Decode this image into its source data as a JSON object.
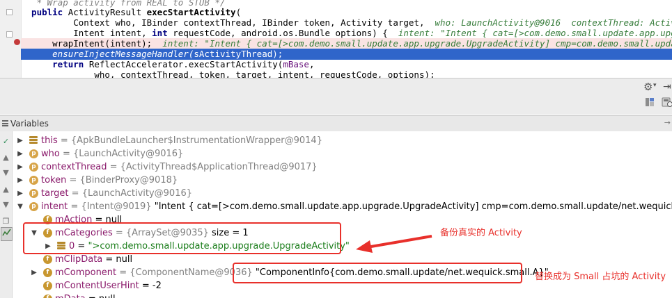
{
  "editor": {
    "lines": [
      {
        "parts": [
          {
            "t": "   * ",
            "c": "cmt"
          },
          {
            "t": "Wrap activity from REAL to STUB */",
            "c": "cmt"
          }
        ]
      },
      {
        "parts": [
          {
            "t": "  public ",
            "c": "kw"
          },
          {
            "t": "ActivityResult ",
            "c": ""
          },
          {
            "t": "execStartActivity",
            "c": "method"
          },
          {
            "t": "(",
            "c": ""
          }
        ]
      },
      {
        "parts": [
          {
            "t": "          Context who, IBinder contextThread, IBinder token, Activity target,  ",
            "c": ""
          },
          {
            "t": "who: LaunchActivity@9016  contextThread: ActivityThread$ApplicationThread@9017",
            "c": "hint"
          }
        ]
      },
      {
        "parts": [
          {
            "t": "          Intent intent, ",
            "c": ""
          },
          {
            "t": "int ",
            "c": "kw"
          },
          {
            "t": "requestCode, android.os.Bundle options) {  ",
            "c": ""
          },
          {
            "t": "intent: \"Intent { cat=[>com.demo.small.update.app.upgrade.UpgradeActivity]",
            "c": "hint"
          }
        ]
      },
      {
        "parts": [
          {
            "t": "      wrapIntent(intent);  ",
            "c": ""
          },
          {
            "t": "intent: \"Intent { cat=[>com.demo.small.update.app.upgrade.UpgradeActivity] cmp=com.demo.small.update/net.wequick.small.A }",
            "c": "hint"
          }
        ]
      },
      {
        "parts": [
          {
            "t": "      ensureInjectMessageHandler(",
            "c": "itl"
          },
          {
            "t": "sActivityThread",
            "c": "field"
          },
          {
            "t": ");",
            "c": ""
          }
        ]
      },
      {
        "parts": [
          {
            "t": "      return ",
            "c": "kw"
          },
          {
            "t": "ReflectAccelerator.",
            "c": ""
          },
          {
            "t": "execStartActivity",
            "c": "itl"
          },
          {
            "t": "(",
            "c": ""
          },
          {
            "t": "mBase",
            "c": "field"
          },
          {
            "t": ",",
            "c": ""
          }
        ]
      },
      {
        "parts": [
          {
            "t": "              who, contextThread, token, target, intent, requestCode, options);",
            "c": ""
          }
        ]
      }
    ]
  },
  "toolbar": {
    "gear_icon": "gear-icon",
    "hide_icon": "hide-icon",
    "restore_icon": "restore-layout-icon",
    "calc_icon": "evaluate-expression-icon"
  },
  "variables_panel": {
    "title": "Variables",
    "rows": [
      {
        "indent": 0,
        "arrow": "▶",
        "icon": "list",
        "name": "this",
        "value": "= {ApkBundleLauncher$InstrumentationWrapper@9014}",
        "extra": ""
      },
      {
        "indent": 0,
        "arrow": "▶",
        "icon": "p",
        "name": "who",
        "value": "= {LaunchActivity@9016}",
        "extra": ""
      },
      {
        "indent": 0,
        "arrow": "▶",
        "icon": "p",
        "name": "contextThread",
        "value": "= {ActivityThread$ApplicationThread@9017}",
        "extra": ""
      },
      {
        "indent": 0,
        "arrow": "▶",
        "icon": "p",
        "name": "token",
        "value": "= {BinderProxy@9018}",
        "extra": ""
      },
      {
        "indent": 0,
        "arrow": "▶",
        "icon": "p",
        "name": "target",
        "value": "= {LaunchActivity@9016}",
        "extra": ""
      },
      {
        "indent": 0,
        "arrow": "▼",
        "icon": "p",
        "name": "intent",
        "value": "= {Intent@9019}",
        "extra": " \"Intent { cat=[>com.demo.small.update.app.upgrade.UpgradeActivity] cmp=com.demo.small.update/net.wequick.small.A }\""
      },
      {
        "indent": 1,
        "arrow": "",
        "icon": "f",
        "name": "mAction",
        "value": "= null",
        "extra": ""
      },
      {
        "indent": 1,
        "arrow": "▼",
        "icon": "f",
        "name": "mCategories",
        "value": "= {ArraySet@9035}",
        "extra": "  size = 1"
      },
      {
        "indent": 2,
        "arrow": "▶",
        "icon": "list",
        "name": "0",
        "value": "=",
        "extra": " \">com.demo.small.update.app.upgrade.UpgradeActivity\""
      },
      {
        "indent": 1,
        "arrow": "",
        "icon": "f",
        "name": "mClipData",
        "value": "= null",
        "extra": ""
      },
      {
        "indent": 1,
        "arrow": "▶",
        "icon": "f",
        "name": "mComponent",
        "value": "= {ComponentName@9036}",
        "extra": " \"ComponentInfo{com.demo.small.update/net.wequick.small.A}\""
      },
      {
        "indent": 1,
        "arrow": "",
        "icon": "f",
        "name": "mContentUserHint",
        "value": "= -2",
        "extra": ""
      },
      {
        "indent": 1,
        "arrow": "",
        "icon": "f",
        "name": "mData",
        "value": "= null",
        "extra": ""
      }
    ]
  },
  "annotations": {
    "note1": "备份真实的 Activity",
    "note2": "替换成为 Small 占坑的 Activity"
  },
  "colors": {
    "exec_line": "#2f65ca",
    "error_line": "#fae3e3",
    "annotation_red": "#e8302b"
  }
}
